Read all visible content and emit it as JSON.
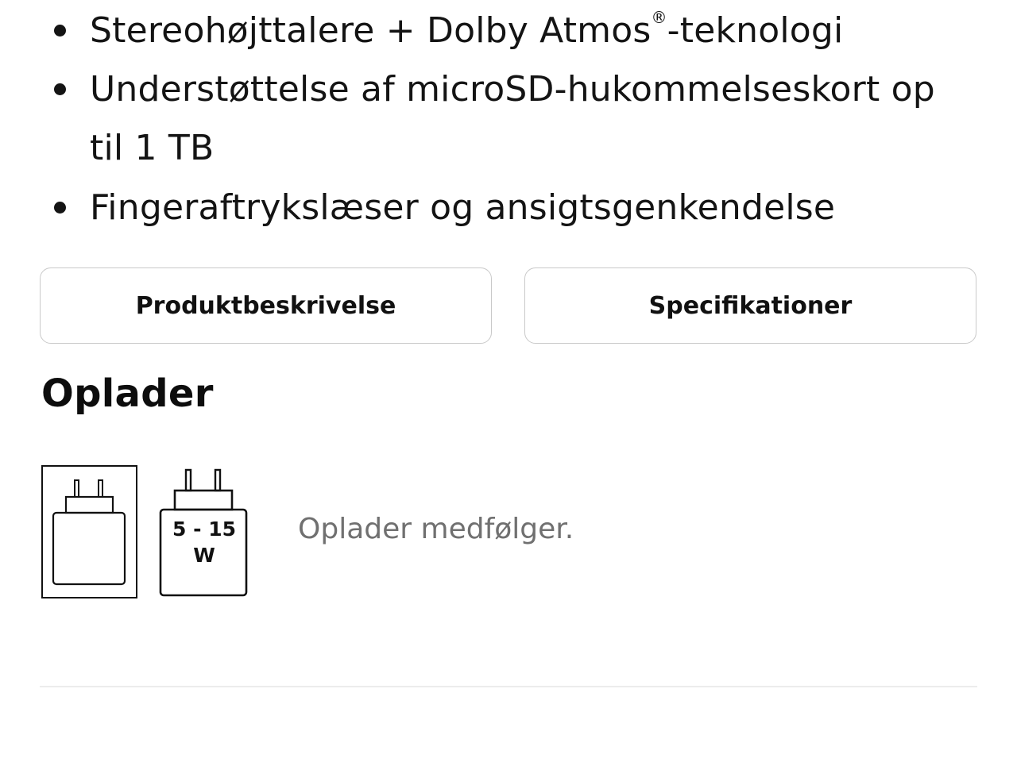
{
  "features": {
    "item1_pre": "Stereohøjttalere + Dolby Atmos",
    "item1_reg": "®",
    "item1_post": "-teknologi",
    "item2_line1": "Understøttelse af microSD-hukommelseskort op",
    "item2_line2": "til 1 TB",
    "item3": "Fingeraftrykslæser og ansigtsgenkendelse"
  },
  "tabs": {
    "description_label": "Produktbeskrivelse",
    "specs_label": "Specifikationer"
  },
  "charger": {
    "title": "Oplader",
    "wattage_line1": "5 - 15",
    "wattage_line2": "W",
    "status_text": "Oplader medfølger.",
    "icons": [
      "charger-included-icon",
      "charger-wattage-icon"
    ]
  },
  "colors": {
    "text": "#141414",
    "muted_text": "#707070",
    "border": "#c9c9c9",
    "divider": "#ececec"
  }
}
